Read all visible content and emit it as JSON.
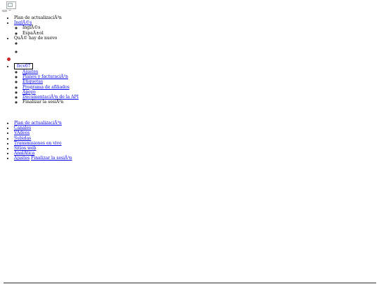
{
  "header": {
    "logo_alt": "",
    "dash": "~"
  },
  "top_nav": {
    "upgrade_text": "Plan de actualizaciÃ³n",
    "language": {
      "current": "InglÃ©s",
      "options": [
        "InglÃ©s",
        "EspaÃ±ol"
      ]
    },
    "whats_new": "QuÃ© hay de nuevo",
    "user": {
      "name": "frcv07",
      "menu": [
        "Ajustes",
        "Planes y facturaciÃ³n",
        "Etiquetas",
        "Programa de afiliados",
        "Apoyo",
        "DocumentaciÃ³n de la API"
      ],
      "logout": "Finalizar la sesiÃ³n"
    }
  },
  "side_nav": {
    "items": [
      "Plan de actualizaciÃ³n",
      "Canales",
      "VÃ­deos",
      "Subidas",
      "Transmisiones en vivo",
      "Sitios web",
      "AnalÃ­tica"
    ],
    "settings": "Ajustes",
    "logout": "Finalizar la sesiÃ³n"
  },
  "colors": {
    "link": "#0000ee",
    "notification": "#c62828",
    "text": "#000000"
  }
}
